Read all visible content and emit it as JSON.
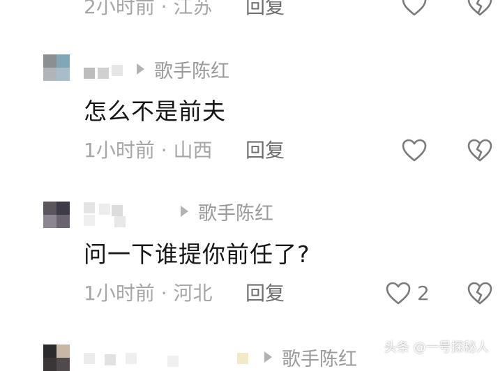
{
  "colors": {
    "text": "#161616",
    "meta": "#a6a6a6",
    "reply": "#6f6f6f",
    "icon": "#7a7a7a",
    "background": "#ffffff"
  },
  "icons": {
    "like": "heart-outline",
    "dislike": "broken-heart-outline",
    "reply_arrow": "triangle-right"
  },
  "comments": [
    {
      "text": "",
      "time": "2小时前",
      "location": "江苏",
      "reply_label": "回复",
      "like_count": ""
    },
    {
      "reply_to": "歌手陈红",
      "text": "怎么不是前夫",
      "time": "1小时前",
      "location": "山西",
      "reply_label": "回复",
      "like_count": ""
    },
    {
      "reply_to": "歌手陈红",
      "text": "问一下谁提你前任了?",
      "time": "1小时前",
      "location": "河北",
      "reply_label": "回复",
      "like_count": "2"
    },
    {
      "reply_to": "歌手陈红"
    }
  ],
  "watermark": "头条 @一号探秘人"
}
